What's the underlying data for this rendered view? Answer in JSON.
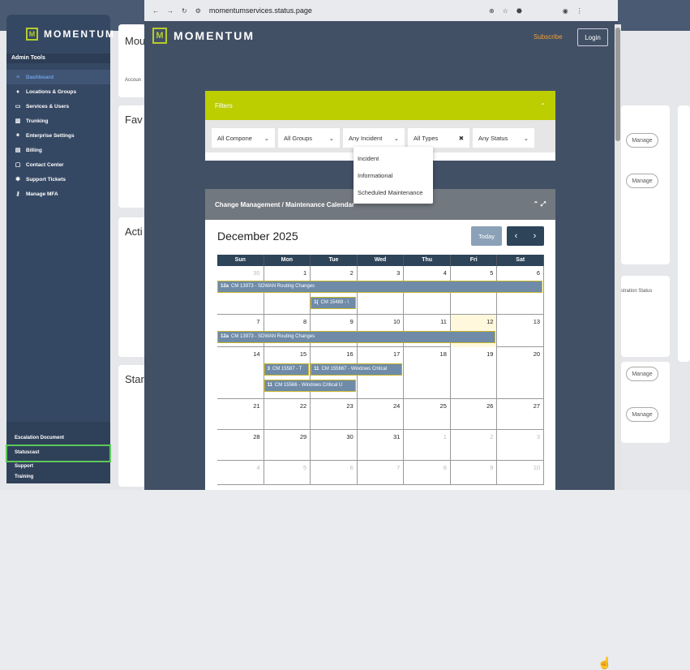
{
  "browser": {
    "url": "momentumservices.status.page"
  },
  "brand": {
    "name": "MOMENTUM",
    "logo_letter": "M"
  },
  "sidebar": {
    "section": "Admin Tools",
    "items": [
      {
        "label": "Dashboard",
        "icon": "dashboard-icon",
        "glyph": "≡",
        "active": true
      },
      {
        "label": "Locations & Groups",
        "icon": "location-pin-icon",
        "glyph": "♦"
      },
      {
        "label": "Services & Users",
        "icon": "services-icon",
        "glyph": "▭"
      },
      {
        "label": "Trunking",
        "icon": "trunking-icon",
        "glyph": "▥"
      },
      {
        "label": "Enterprise Settings",
        "icon": "enterprise-icon",
        "glyph": "⚹"
      },
      {
        "label": "Billing",
        "icon": "billing-icon",
        "glyph": "▤"
      },
      {
        "label": "Contact Center",
        "icon": "contact-center-icon",
        "glyph": "▢"
      },
      {
        "label": "Support Tickets",
        "icon": "support-icon",
        "glyph": "✱"
      },
      {
        "label": "Manage MFA",
        "icon": "mfa-icon",
        "glyph": "⚷"
      }
    ],
    "bottom": [
      "Escalation Document",
      "Statuscast",
      "Support",
      "Training",
      "Training"
    ]
  },
  "background": {
    "t1": "Mou",
    "t2": "Fav",
    "t3": "Acti",
    "t4": "Star",
    "col_label": "stration Status",
    "manage": "Manage",
    "accou": "Accoun"
  },
  "statuspage": {
    "subscribe": "Subscribe",
    "login": "Login"
  },
  "filters": {
    "title": "Filters",
    "selects": [
      "All Compone",
      "All Groups",
      "Any Incident",
      "All Types",
      "Any Status"
    ],
    "type_options": [
      "Incident",
      "Informational",
      "Scheduled Maintenance"
    ]
  },
  "calendar": {
    "title": "Change Management / Maintenance Calendar",
    "month": "December 2025",
    "today_label": "Today",
    "dow": [
      "Sun",
      "Mon",
      "Tue",
      "Wed",
      "Thu",
      "Fri",
      "Sat"
    ],
    "weeks": [
      [
        "30",
        "1",
        "2",
        "3",
        "4",
        "5",
        "6"
      ],
      [
        "7",
        "8",
        "9",
        "10",
        "11",
        "12",
        "13"
      ],
      [
        "14",
        "15",
        "16",
        "17",
        "18",
        "19",
        "20"
      ],
      [
        "21",
        "22",
        "23",
        "24",
        "25",
        "26",
        "27"
      ],
      [
        "28",
        "29",
        "30",
        "31",
        "1",
        "2",
        "3"
      ],
      [
        "4",
        "5",
        "6",
        "7",
        "8",
        "9",
        "10"
      ]
    ],
    "events": {
      "e1": {
        "time": "12a",
        "text": "CM 13973 - SDWAN Routing Changes"
      },
      "e2": {
        "time": "1(",
        "text": "CM 15489 - \\"
      },
      "e3": {
        "time": "12a",
        "text": "CM 13973 - SDWAN Routing Changes"
      },
      "e4": {
        "time": "3",
        "text": "CM 15587 - T"
      },
      "e5": {
        "time": "11",
        "text": "CM 155667 - Windows Critical"
      },
      "e6": {
        "time": "11",
        "text": "CM 15566 - Windows Critical U"
      }
    }
  },
  "colors": {
    "accent": "#bccd00",
    "nav": "#2d4459",
    "sidebar": "#354863"
  }
}
